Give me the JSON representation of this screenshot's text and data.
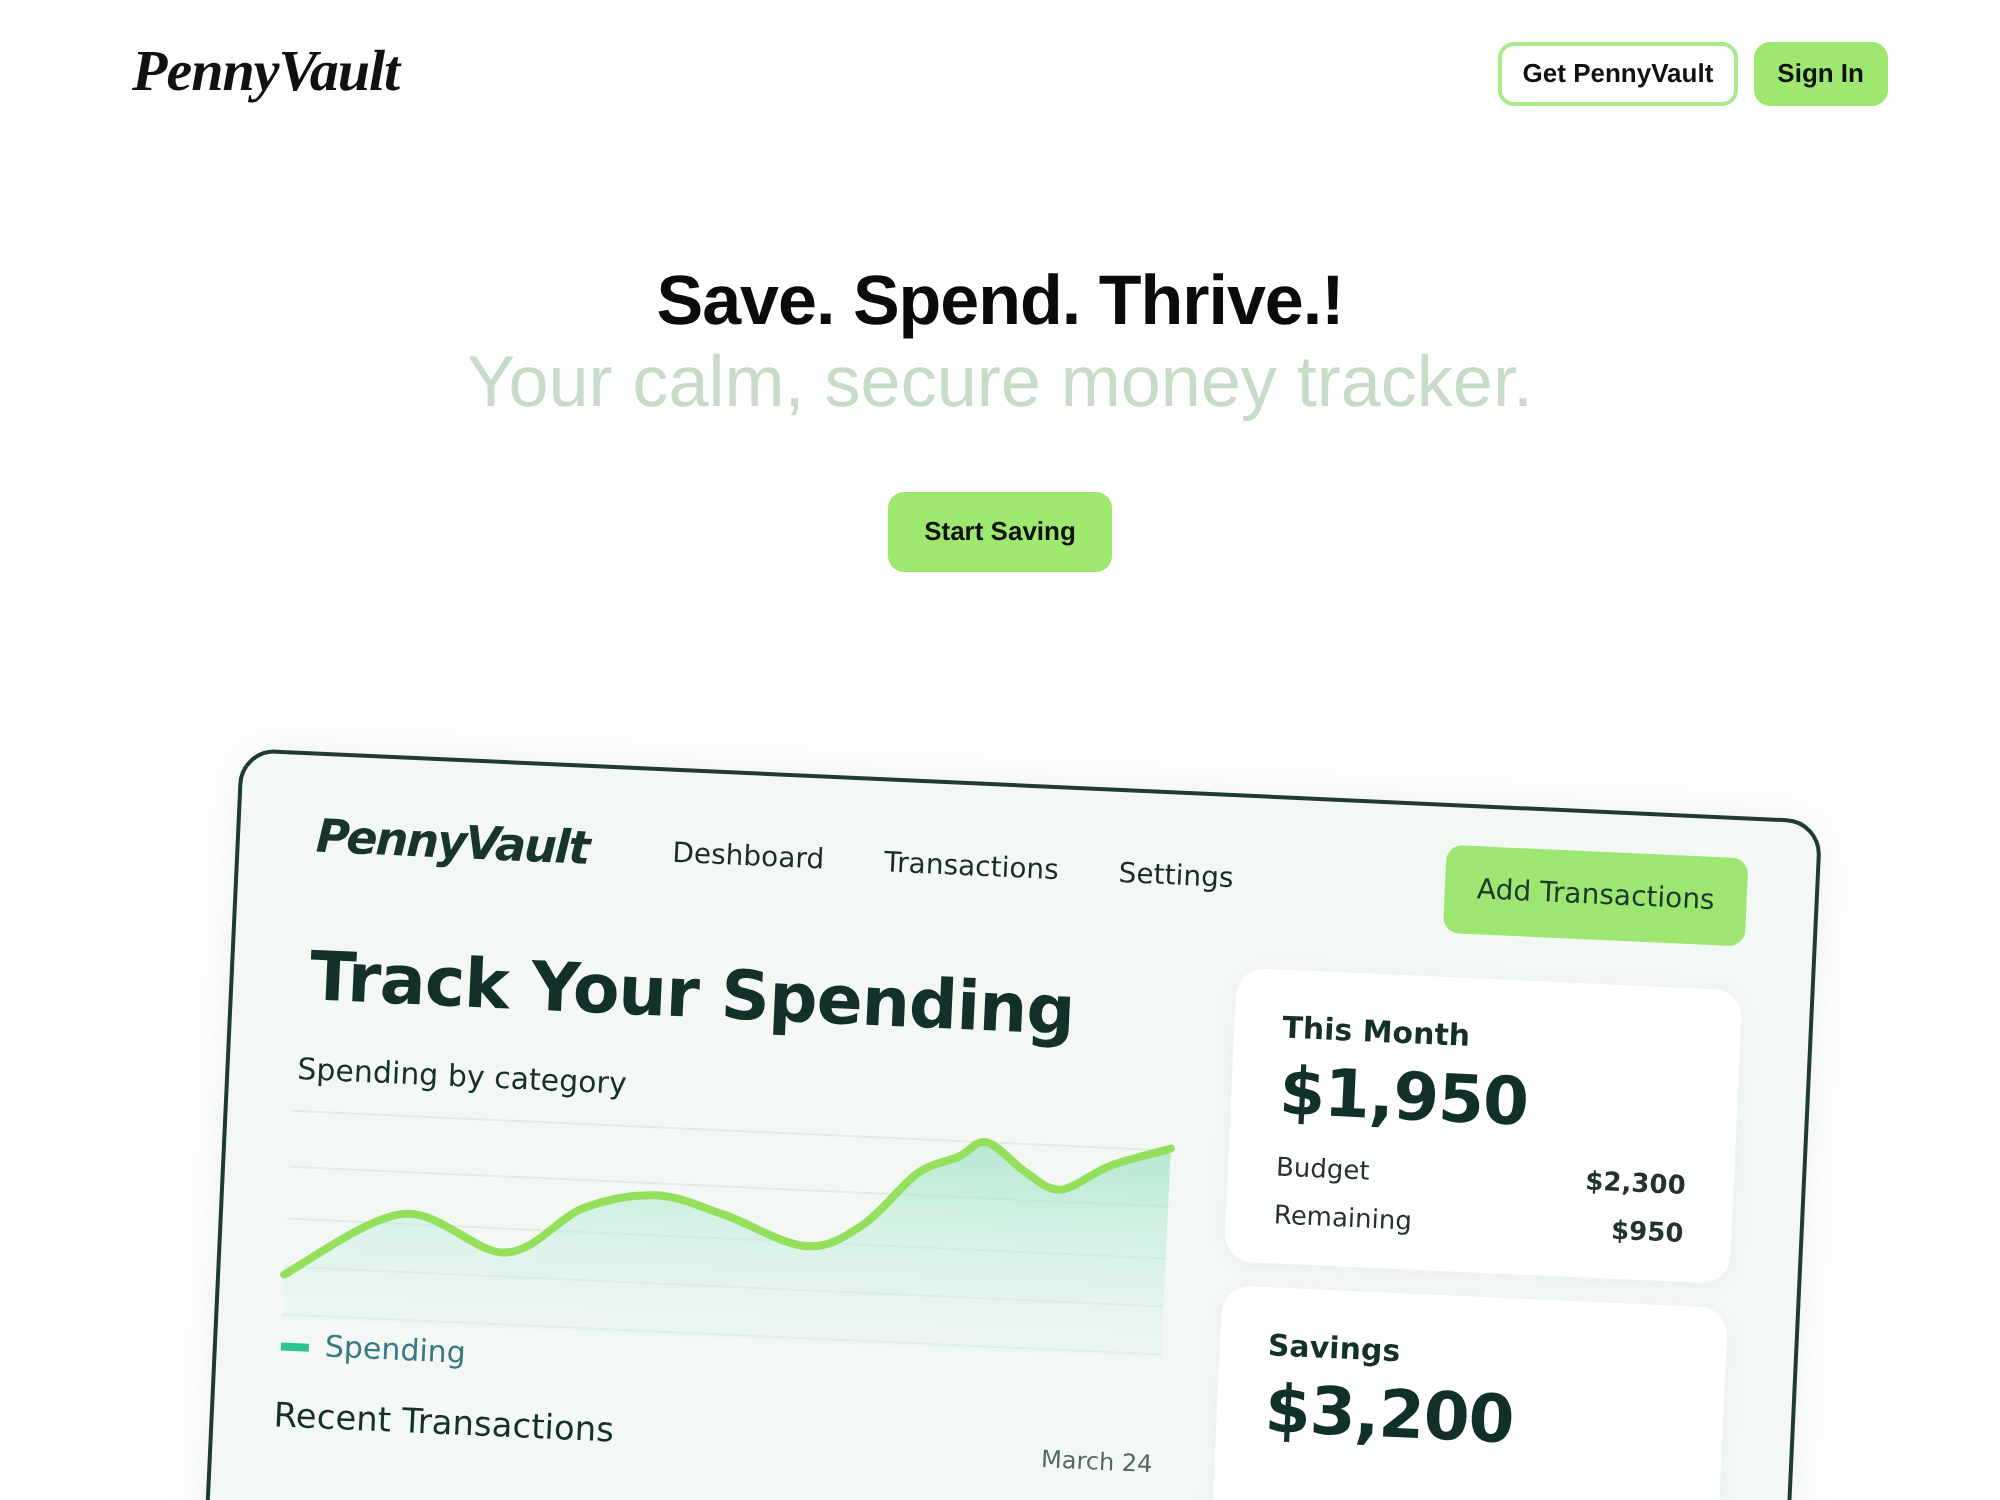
{
  "header": {
    "logo": "PennyVault",
    "buttons": [
      {
        "label": "Get PennyVault",
        "kind": "outline"
      },
      {
        "label": "Sign In",
        "kind": "filled"
      }
    ]
  },
  "hero": {
    "title": "Save. Spend. Thrive.!",
    "subtitle": "Your calm, secure money tracker.",
    "cta": "Start Saving"
  },
  "preview": {
    "logo": "PennyVault",
    "nav": [
      "Deshboard",
      "Transactions",
      "Settings"
    ],
    "action": "Add Transactions",
    "heading": "Track Your Spending",
    "chart": {
      "title": "Spending by category",
      "legend": "Spending"
    },
    "recent": {
      "title": "Recent Transactions",
      "date": "March 24"
    },
    "cards": [
      {
        "title": "This Month",
        "amount": "$1,950",
        "rows": [
          {
            "label": "Budget",
            "value": "$2,300"
          },
          {
            "label": "Remaining",
            "value": "$950"
          }
        ]
      },
      {
        "title": "Savings",
        "amount": "$3,200"
      }
    ]
  }
}
